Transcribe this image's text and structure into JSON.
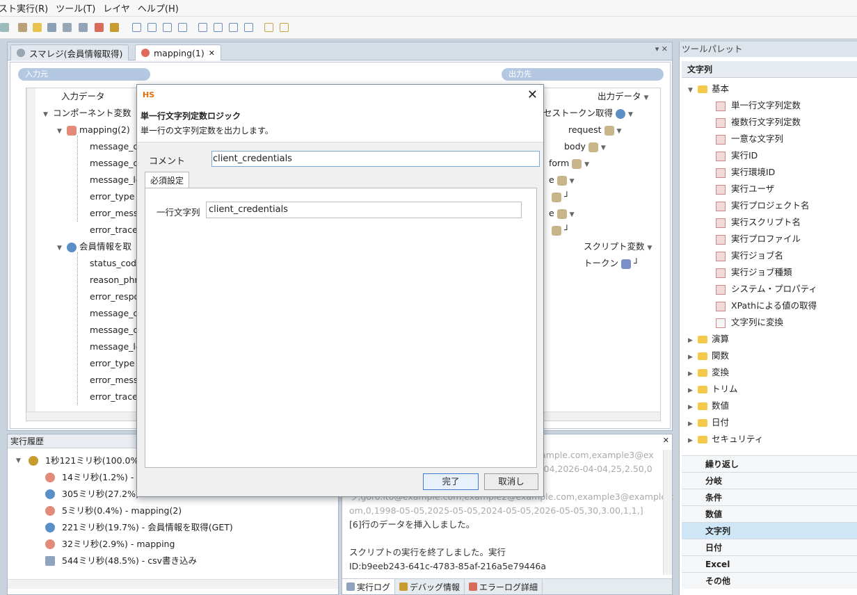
{
  "menu": [
    "スト実行(R)",
    "ツール(T)",
    "レイヤ",
    "ヘルプ(H)"
  ],
  "editor": {
    "tabs": [
      {
        "label": "スマレジ(会員情報取得)"
      },
      {
        "label": "mapping(1)",
        "close": "✕"
      }
    ],
    "input_section": "入力元",
    "output_section": "出力先",
    "input_tree": {
      "header": "入力データ",
      "rows": [
        "コンポーネント変数",
        "mapping(2)",
        "message_ca",
        "message_co",
        "message_le",
        "error_type",
        "error_mess",
        "error_trace",
        "会員情報を取",
        "status_code",
        "reason_phr",
        "error_respo",
        "message_ca",
        "message_co",
        "message_le",
        "error_type",
        "error_mess",
        "error_trace"
      ]
    },
    "output_tree": {
      "header": "出力データ",
      "rows": [
        "セストークン取得",
        "request",
        "body",
        "form",
        "e",
        "e",
        "スクリプト変数",
        "トークン"
      ]
    }
  },
  "history": {
    "title": "実行履歴",
    "rows": [
      "1秒121ミリ秒(100.0%",
      "14ミリ秒(1.2%) - r",
      "305ミリ秒(27.2%)",
      "5ミリ秒(0.4%) - mapping(2)",
      "221ミリ秒(19.7%) - 会員情報を取得(GET)",
      "32ミリ秒(2.9%) - mapping",
      "544ミリ秒(48.5%) - csv書き込み"
    ]
  },
  "log": {
    "lines": [
      "ample.com,example3@ex",
      "-04,2026-04-04,25,2.50,0",
      "",
      "ウ,goro.ito@example.com,example2@example.com,example3@example.c",
      "om,0,1998-05-05,2025-05-05,2024-05-05,2026-05-05,30,3.00,1,1,]",
      "[6]行のデータを挿入しました。",
      "",
      "スクリプトの実行を終了しました。実行",
      "ID:b9eeb243-641c-4783-85af-216a5e79446a"
    ],
    "tabs": [
      "実行ログ",
      "デバッグ情報",
      "エラーログ詳細"
    ]
  },
  "palette": {
    "title": "ツールパレット",
    "subtitle": "文字列",
    "basic_folder": "基本",
    "basic_items": [
      "単一行文字列定数",
      "複数行文字列定数",
      "一意な文字列",
      "実行ID",
      "実行環境ID",
      "実行ユーザ",
      "実行プロジェクト名",
      "実行スクリプト名",
      "実行プロファイル",
      "実行ジョブ名",
      "実行ジョブ種類",
      "システム・プロパティ",
      "XPathによる値の取得",
      "文字列に変換"
    ],
    "folders": [
      "演算",
      "関数",
      "変換",
      "トリム",
      "数値",
      "日付",
      "セキュリティ"
    ],
    "categories": [
      "繰り返し",
      "分岐",
      "条件",
      "数値",
      "文字列",
      "日付",
      "Excel",
      "その他"
    ],
    "selected_category": "文字列"
  },
  "dialog": {
    "logo": "HS",
    "close": "✕",
    "heading": "単一行文字列定数ロジック",
    "description": "単一行の文字列定数を出力します。",
    "comment_label": "コメント",
    "comment_value": "client_credentials",
    "tab_label": "必須設定",
    "string_label": "一行文字列",
    "string_value": "client_credentials",
    "ok": "完了",
    "cancel": "取消し"
  },
  "colors": {
    "accent": "#3d7bd1",
    "selected_category_bg": "#cfe6f7",
    "logo": "#e8700a"
  }
}
